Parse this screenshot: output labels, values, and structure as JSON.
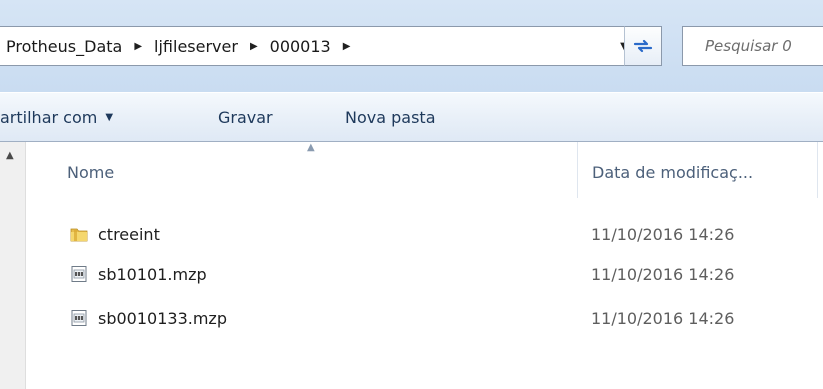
{
  "address_bar": {
    "breadcrumbs": [
      "Protheus_Data",
      "ljfileserver",
      "000013"
    ],
    "search_placeholder": "Pesquisar 0"
  },
  "command_bar": {
    "share_label": "artilhar com",
    "burn_label": "Gravar",
    "new_folder_label": "Nova pasta"
  },
  "columns": {
    "name": "Nome",
    "date": "Data de modificaç..."
  },
  "files": [
    {
      "name": "ctreeint",
      "date": "11/10/2016 14:26",
      "icon": "folder-icon"
    },
    {
      "name": "sb10101.mzp",
      "date": "11/10/2016 14:26",
      "icon": "file-icon"
    },
    {
      "name": "sb0010133.mzp",
      "date": "11/10/2016 14:26",
      "icon": "file-icon"
    }
  ],
  "colors": {
    "address_bg": "#cfe0f3",
    "command_bar_text": "#1e395b",
    "header_text": "#4c607a"
  }
}
